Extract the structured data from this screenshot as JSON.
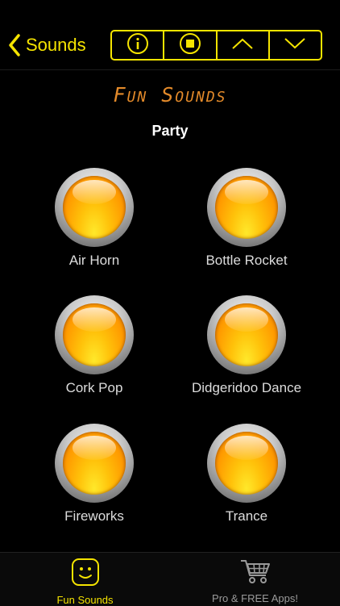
{
  "colors": {
    "accent": "#f5e400",
    "title": "#e38a2a",
    "button_face": "#ffb000",
    "background": "#000000"
  },
  "navbar": {
    "back_label": "Sounds",
    "back_icon": "chevron-left-icon",
    "segments": [
      {
        "name": "info-icon"
      },
      {
        "name": "stop-icon"
      },
      {
        "name": "chevron-up-icon"
      },
      {
        "name": "chevron-down-icon"
      }
    ]
  },
  "header": {
    "title": "Fun Sounds",
    "category": "Party"
  },
  "sounds": [
    {
      "label": "Air Horn"
    },
    {
      "label": "Bottle Rocket"
    },
    {
      "label": "Cork Pop"
    },
    {
      "label": "Didgeridoo Dance"
    },
    {
      "label": "Fireworks"
    },
    {
      "label": "Trance"
    }
  ],
  "tabbar": {
    "tabs": [
      {
        "label": "Fun Sounds",
        "icon": "smiley-icon",
        "active": true
      },
      {
        "label": "Pro & FREE Apps!",
        "icon": "cart-icon",
        "active": false
      }
    ]
  }
}
